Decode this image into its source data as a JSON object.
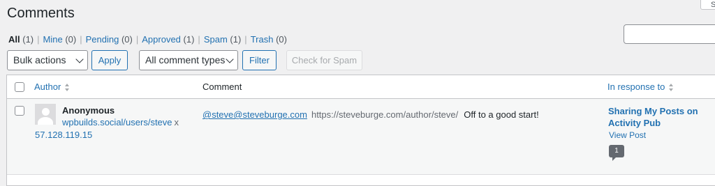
{
  "page": {
    "title": "Comments",
    "screen_options": "S"
  },
  "filters": [
    {
      "label": "All",
      "count": "(1)",
      "current": true
    },
    {
      "label": "Mine",
      "count": "(0)"
    },
    {
      "label": "Pending",
      "count": "(0)"
    },
    {
      "label": "Approved",
      "count": "(1)"
    },
    {
      "label": "Spam",
      "count": "(1)"
    },
    {
      "label": "Trash",
      "count": "(0)"
    }
  ],
  "toolbar": {
    "bulk_actions": "Bulk actions",
    "apply": "Apply",
    "comment_types": "All comment types",
    "filter": "Filter",
    "check_spam": "Check for Spam"
  },
  "table": {
    "headers": {
      "author": "Author",
      "comment": "Comment",
      "in_response_to": "In response to"
    },
    "row": {
      "author_name": "Anonymous",
      "author_url": "wpbuilds.social/users/steve",
      "author_url_suffix": "x",
      "author_ip": "57.128.119.15",
      "comment_email": "@steve@steveburge.com",
      "comment_url": "https://steveburge.com/author/steve/",
      "comment_text": "Off to a good start!",
      "response_title": "Sharing My Posts on Activity Pub",
      "view_post": "View Post",
      "comment_count": "1"
    }
  },
  "colors": {
    "link": "#2271b1",
    "text": "#1d2327",
    "muted": "#646970",
    "background": "#f0f0f1"
  }
}
